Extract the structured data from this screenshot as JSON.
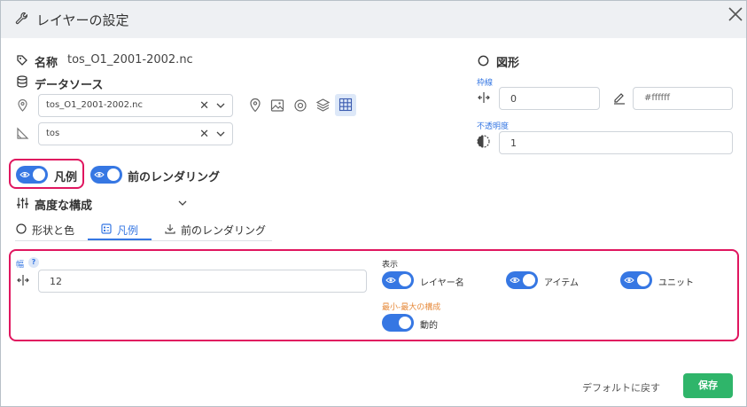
{
  "header": {
    "title": "レイヤーの設定"
  },
  "name": {
    "label": "名称",
    "value": "tos_O1_2001-2002.nc"
  },
  "datasource": {
    "label": "データソース",
    "file_select": "tos_O1_2001-2002.nc",
    "variable_select": "tos"
  },
  "shape": {
    "label": "図形",
    "stroke_label": "枠線",
    "stroke_width": "0",
    "stroke_color_placeholder": "#ffffff",
    "opacity_label": "不透明度",
    "opacity_value": "1"
  },
  "toggles": {
    "legend": "凡例",
    "prev_render": "前のレンダリング"
  },
  "advanced": {
    "label": "高度な構成"
  },
  "tabs": [
    {
      "label": "形状と色"
    },
    {
      "label": "凡例"
    },
    {
      "label": "前のレンダリング"
    }
  ],
  "legend_panel": {
    "width_label": "幅",
    "help": "?",
    "width_value": "12",
    "display_label": "表示",
    "layer_name": "レイヤー名",
    "item": "アイテム",
    "unit": "ユニット",
    "minmax_label": "最小-最大の構成",
    "dynamic": "動的"
  },
  "footer": {
    "reset": "デフォルトに戻す",
    "save": "保存"
  },
  "colors": {
    "accent": "#3677e3",
    "highlight": "#e0165f",
    "save": "#2fb56a",
    "orange": "#e6893a"
  }
}
